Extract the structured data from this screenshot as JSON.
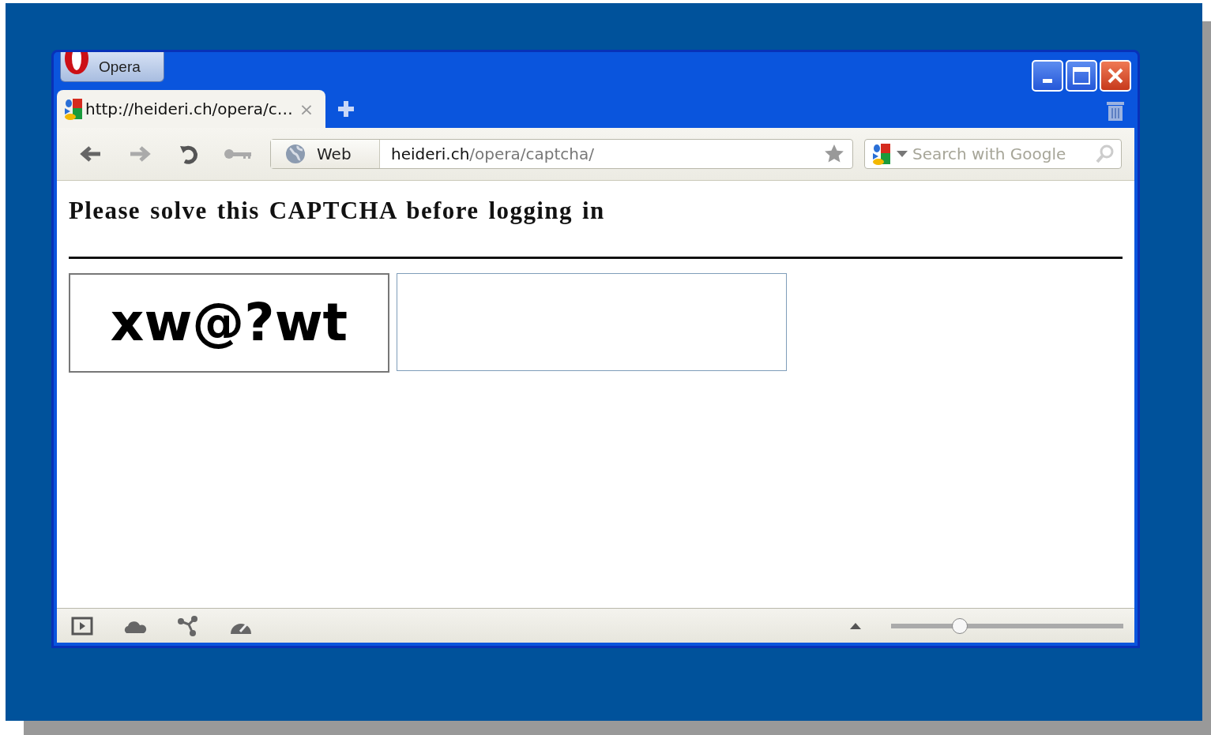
{
  "app_button": {
    "label": "Opera"
  },
  "tabs": [
    {
      "title": "http://heideri.ch/opera/c…",
      "close": "×",
      "selected": true
    }
  ],
  "address_bar": {
    "mode": "Web",
    "domain": "heideri.ch",
    "path": "/opera/captcha/"
  },
  "search": {
    "placeholder": "Search with Google"
  },
  "page": {
    "heading": "Please solve this CAPTCHA before logging in",
    "captcha_text": "xw@?wt"
  },
  "status_bar": {
    "zoom": {
      "level": 0.28
    }
  }
}
